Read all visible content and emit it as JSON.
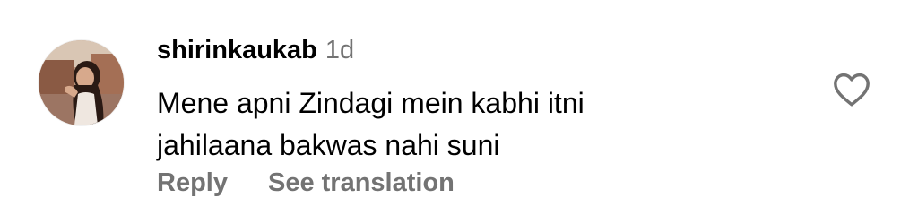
{
  "comment": {
    "username": "shirinkaukab",
    "timestamp": "1d",
    "text_lines": [
      "Mene apni Zindagi mein kabhi itni",
      "jahilaana bakwas nahi suni"
    ],
    "avatar_icon": "profile-photo",
    "like_icon": "heart-outline-icon"
  },
  "actions": {
    "reply_label": "Reply",
    "translate_label": "See translation"
  },
  "colors": {
    "primary_text": "#000000",
    "secondary_text": "#737373",
    "background": "#ffffff"
  }
}
